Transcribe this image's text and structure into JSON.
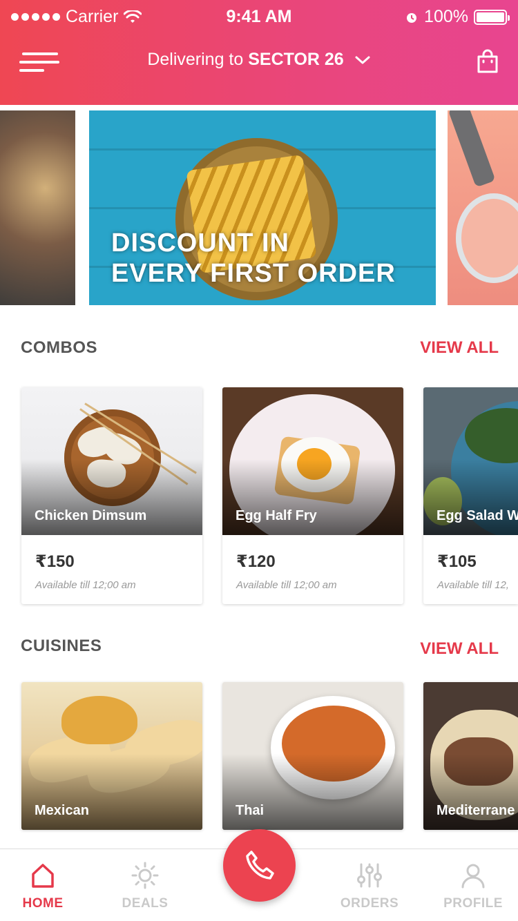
{
  "status_bar": {
    "carrier": "Carrier",
    "time": "9:41 AM",
    "battery": "100%",
    "icons": [
      "signal-dots-icon",
      "wifi-icon",
      "alarm-icon",
      "battery-icon"
    ]
  },
  "header": {
    "location_prefix": "Delivering to",
    "location_name": "SECTOR 26",
    "icons": [
      "menu-icon",
      "chevron-down-icon",
      "shopping-bag-icon"
    ]
  },
  "banner": {
    "title_line1": "DISCOUNT IN",
    "title_line2": "EVERY FIRST ORDER"
  },
  "combos": {
    "title": "COMBOS",
    "view_all": "VIEW ALL",
    "items": [
      {
        "name": "Chicken Dimsum",
        "price": "₹150",
        "availability": "Available till 12;00 am"
      },
      {
        "name": "Egg Half Fry",
        "price": "₹120",
        "availability": "Available till 12;00 am"
      },
      {
        "name": "Egg Salad W",
        "price": "₹105",
        "availability": "Available till 12,"
      }
    ]
  },
  "cuisines": {
    "title": "CUISINES",
    "view_all": "VIEW ALL",
    "items": [
      {
        "name": "Mexican"
      },
      {
        "name": "Thai"
      },
      {
        "name": "Mediterrane"
      }
    ]
  },
  "tabbar": {
    "tabs": [
      {
        "label": "HOME",
        "icon": "home-icon",
        "active": true
      },
      {
        "label": "DEALS",
        "icon": "sun-icon",
        "active": false
      },
      {
        "label": "ORDERS",
        "icon": "sliders-icon",
        "active": false
      },
      {
        "label": "PROFILE",
        "icon": "user-icon",
        "active": false
      }
    ],
    "call_icon": "phone-icon"
  },
  "colors": {
    "accent": "#e5394a",
    "header_gradient_start": "#ef4753",
    "header_gradient_end": "#e84590",
    "inactive_tab": "#c9c9c9"
  }
}
